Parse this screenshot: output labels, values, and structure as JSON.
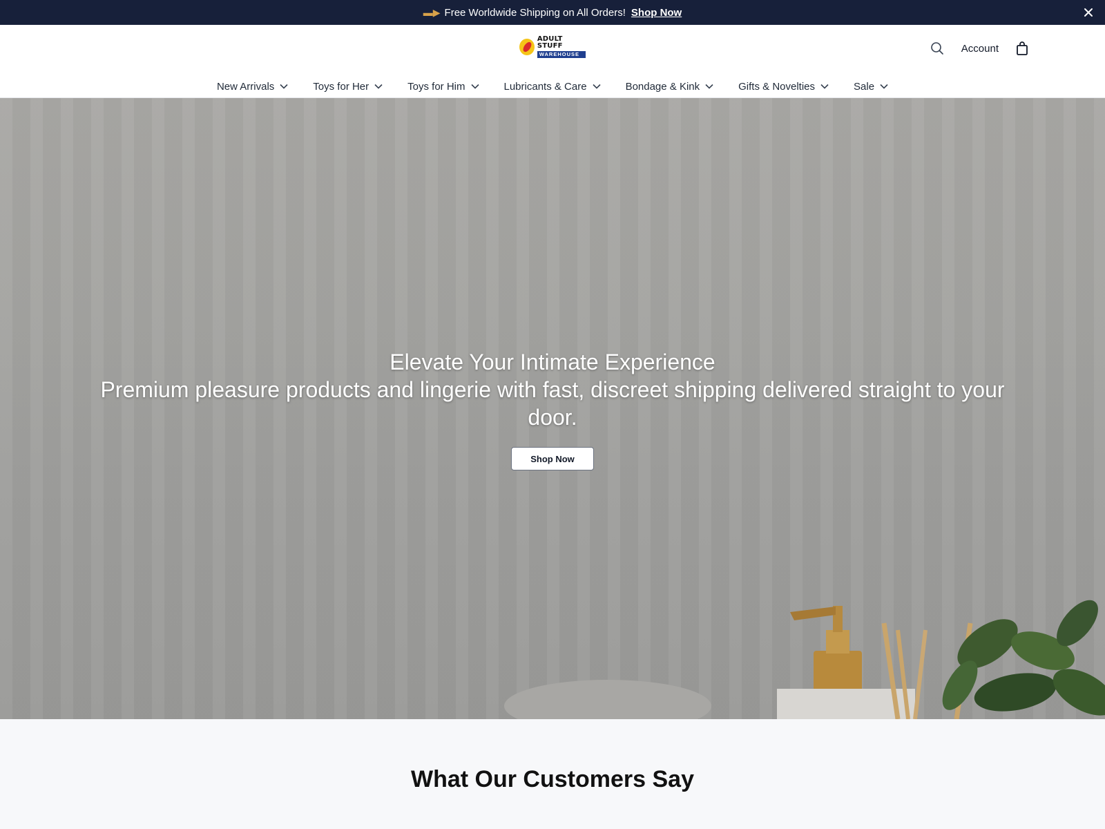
{
  "announcement": {
    "icon": "delivery-truck-icon",
    "text": "Free Worldwide Shipping on All Orders!",
    "link": "Shop Now"
  },
  "header": {
    "logo": {
      "line1": "ADULT STUFF",
      "line2": "WAREHOUSE"
    },
    "account_label": "Account"
  },
  "nav": {
    "items": [
      {
        "label": "New Arrivals"
      },
      {
        "label": "Toys for Her"
      },
      {
        "label": "Toys for Him"
      },
      {
        "label": "Lubricants & Care"
      },
      {
        "label": "Bondage & Kink"
      },
      {
        "label": "Gifts & Novelties"
      },
      {
        "label": "Sale"
      }
    ]
  },
  "hero": {
    "title": "Elevate Your Intimate Experience",
    "subtitle": "Premium pleasure products and lingerie with fast, discreet shipping delivered straight to your door.",
    "button": "Shop Now"
  },
  "testimonials": {
    "heading": "What Our Customers Say"
  },
  "colors": {
    "announcement_bg": "#17203a",
    "logo_badge": "#f5c518",
    "logo_accent": "#d92b2b",
    "logo_banner": "#1f3f8f"
  }
}
